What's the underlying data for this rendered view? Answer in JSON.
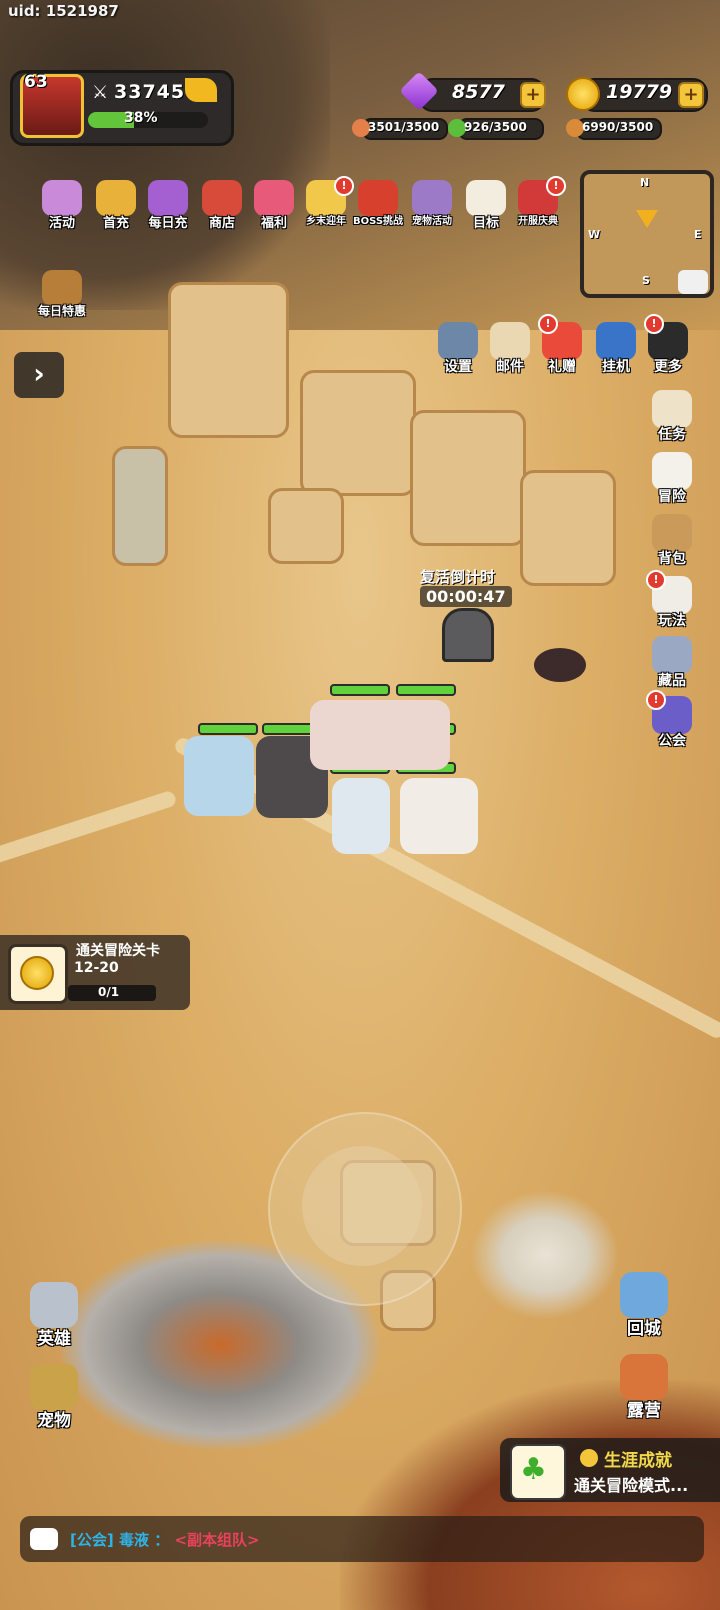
{
  "uid": "uid: 1521987",
  "player": {
    "level": "63",
    "power": "337456",
    "xp_percent_text": "38%",
    "xp_fraction": 0.38
  },
  "currency": {
    "gems": "8577",
    "gold": "19779"
  },
  "resources": [
    {
      "icon": "meat-icon",
      "text": "3501/3500",
      "color": "#e6804a"
    },
    {
      "icon": "leaf-icon",
      "text": "926/3500",
      "color": "#5cbf3c"
    },
    {
      "icon": "ore-icon",
      "text": "6990/3500",
      "color": "#d98b3a"
    }
  ],
  "top_icons": [
    {
      "name": "activity",
      "label": "活动",
      "color": "#c98ad9",
      "badge": false
    },
    {
      "name": "first-recharge",
      "label": "首充",
      "color": "#e8b23a",
      "badge": false
    },
    {
      "name": "daily-recharge",
      "label": "每日充",
      "color": "#a45fd0",
      "badge": false
    },
    {
      "name": "shop",
      "label": "商店",
      "color": "#d84a3a",
      "badge": false
    },
    {
      "name": "welfare",
      "label": "福利",
      "color": "#e85a7a",
      "badge": false
    },
    {
      "name": "village-new-year",
      "label": "乡末迎年",
      "color": "#f2c84a",
      "badge": true
    },
    {
      "name": "boss-challenge",
      "label": "BOSS挑战",
      "color": "#d8402e",
      "badge": false
    },
    {
      "name": "pet-event",
      "label": "宠物活动",
      "color": "#9c7ac8",
      "badge": false
    },
    {
      "name": "goal",
      "label": "目标",
      "color": "#f3ede0",
      "badge": false
    },
    {
      "name": "server-celebration",
      "label": "开服庆典",
      "color": "#d23a3a",
      "badge": true
    }
  ],
  "daily_deal": {
    "label": "每日特惠"
  },
  "minimap": {
    "n": "N",
    "s": "S",
    "e": "E",
    "w": "W"
  },
  "tool_icons": [
    {
      "name": "settings",
      "label": "设置",
      "badge": false,
      "color": "#6d87a8"
    },
    {
      "name": "mail",
      "label": "邮件",
      "badge": false,
      "color": "#e9d8b2"
    },
    {
      "name": "gift",
      "label": "礼赠",
      "badge": true,
      "color": "#e94a3a"
    },
    {
      "name": "idle",
      "label": "挂机",
      "badge": false,
      "color": "#3a74c9"
    },
    {
      "name": "more",
      "label": "更多",
      "badge": true,
      "color": "#2b2b2b"
    }
  ],
  "side_icons": [
    {
      "name": "task",
      "label": "任务",
      "badge": false,
      "color": "#eee3c8"
    },
    {
      "name": "adventure",
      "label": "冒险",
      "badge": false,
      "color": "#f4f1ea"
    },
    {
      "name": "backpack",
      "label": "背包",
      "badge": false,
      "color": "#c99a5a"
    },
    {
      "name": "gameplay",
      "label": "玩法",
      "badge": true,
      "color": "#f0ede6"
    },
    {
      "name": "collection",
      "label": "藏品",
      "badge": false,
      "color": "#9aa8c4"
    },
    {
      "name": "guild",
      "label": "公会",
      "badge": true,
      "color": "#6b5ec8"
    }
  ],
  "revive": {
    "label": "复活倒计时",
    "time": "00:00:47"
  },
  "ally_name": "毒液",
  "quest": {
    "title": "通关冒险关卡",
    "stage": "12-20",
    "progress": "0/1"
  },
  "bottom_left": [
    {
      "name": "hero",
      "label": "英雄",
      "color": "#b9c2cc"
    },
    {
      "name": "pet",
      "label": "宠物",
      "color": "#c9a24a"
    }
  ],
  "bottom_right": [
    {
      "name": "return-city",
      "label": "回城",
      "color": "#6fa8dc"
    },
    {
      "name": "camp",
      "label": "露营",
      "color": "#d9743a"
    }
  ],
  "achievement": {
    "title": "生涯成就",
    "desc": "通关冒险模式..."
  },
  "chat": {
    "channel": "[公会]",
    "name": "毒液",
    "sep": "：",
    "message": "<副本组队>"
  },
  "colors": {
    "hp_green": "#5fd23c",
    "panel_dark": "#2e2a2a",
    "gold": "#f2c53a"
  }
}
